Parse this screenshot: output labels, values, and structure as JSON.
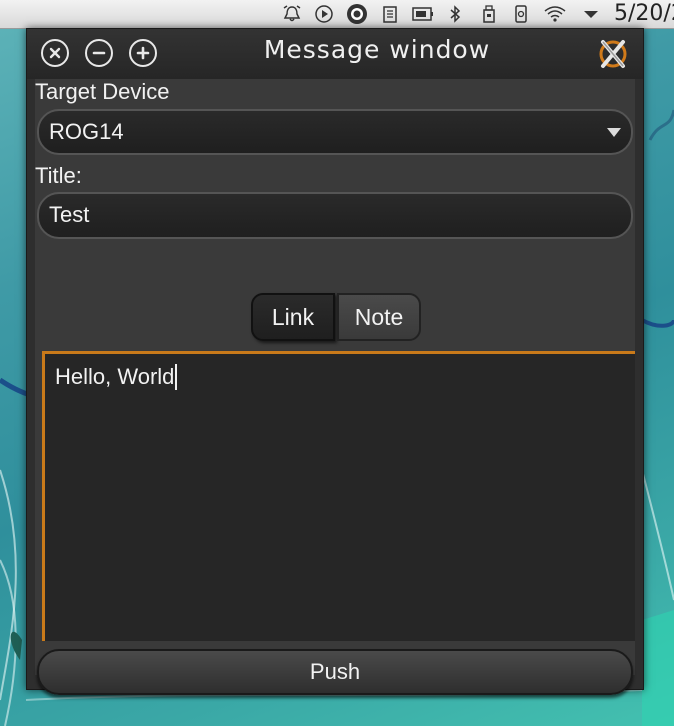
{
  "panel": {
    "clock": "5/20/2",
    "tray_icons": [
      "alarm-icon",
      "media-play-icon",
      "kdeconnect-icon",
      "clipboard-icon",
      "battery-icon",
      "bluetooth-icon",
      "usb-drive-icon",
      "phone-icon",
      "wifi-icon",
      "expand-arrow-icon"
    ]
  },
  "window": {
    "title": "Message window",
    "buttons": [
      "close",
      "minimize",
      "maximize"
    ]
  },
  "form": {
    "target_label": "Target Device",
    "target_value": "ROG14",
    "title_label": "Title:",
    "title_value": "Test",
    "tabs": [
      {
        "label": "Link",
        "selected": true
      },
      {
        "label": "Note",
        "selected": false
      }
    ],
    "note_text": "Hello, World",
    "push_label": "Push"
  },
  "colors": {
    "accent_border": "#c97a1a",
    "window_bg": "#3a3a3a"
  }
}
